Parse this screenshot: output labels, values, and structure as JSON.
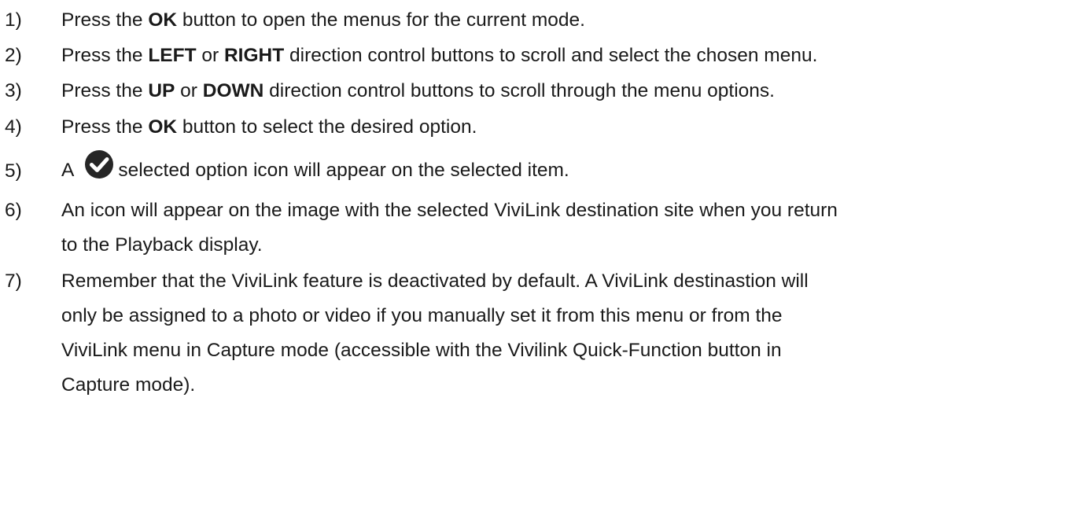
{
  "steps": [
    {
      "num": "1)",
      "parts": [
        "Press the ",
        "OK",
        " button to open the menus for the current mode."
      ]
    },
    {
      "num": "2)",
      "parts": [
        "Press the ",
        "LEFT",
        " or ",
        "RIGHT",
        " direction control buttons to scroll and select the chosen menu."
      ]
    },
    {
      "num": "3)",
      "parts": [
        "Press the ",
        "UP",
        " or ",
        "DOWN",
        " direction control buttons to scroll through the menu options."
      ]
    },
    {
      "num": "4)",
      "parts": [
        "Press the ",
        "OK",
        " button to select the desired option."
      ]
    },
    {
      "num": "5)",
      "prefix": "A",
      "icon": "check-circle-icon",
      "suffix": "selected option icon will appear on the selected item."
    },
    {
      "num": "6)",
      "lines": [
        "An icon will appear on the image with the selected ViviLink destination site when you return",
        "to the Playback display."
      ]
    },
    {
      "num": "7)",
      "lines": [
        "Remember that the ViviLink feature is deactivated by default. A ViviLink destinastion will",
        "only be assigned to a photo or video if you manually set it from this menu or from the",
        "ViviLink menu in Capture mode (accessible with the Vivilink Quick-Function button in",
        "Capture mode)."
      ]
    }
  ]
}
